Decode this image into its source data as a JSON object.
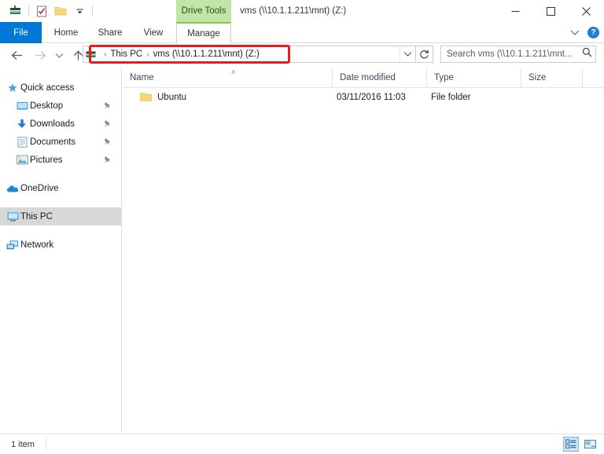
{
  "window": {
    "title": "vms (\\\\10.1.1.211\\mnt) (Z:)",
    "contextual_tab_group": "Drive Tools",
    "minimize_label": "—",
    "maximize_label": "☐",
    "close_label": "✕"
  },
  "quick_access_toolbar": {
    "items": [
      {
        "name": "map-network-drive-icon",
        "label": ""
      },
      {
        "name": "properties-icon",
        "label": ""
      },
      {
        "name": "new-folder-icon",
        "label": ""
      },
      {
        "name": "customize-qat-chevron-icon",
        "label": "∴"
      }
    ]
  },
  "ribbon": {
    "tabs": [
      {
        "label": "File",
        "state": "file"
      },
      {
        "label": "Home",
        "state": "normal"
      },
      {
        "label": "Share",
        "state": "normal"
      },
      {
        "label": "View",
        "state": "normal"
      },
      {
        "label": "Manage",
        "state": "active"
      }
    ],
    "expand_icon": "⌄",
    "help_label": "?"
  },
  "navigation": {
    "back_icon": "←",
    "forward_icon": "→",
    "recent_icon": "⌄",
    "up_icon": "↑",
    "address": {
      "crumbs": [
        "This PC",
        "vms (\\\\10.1.1.211\\mnt) (Z:)"
      ],
      "separator": "›",
      "dropdown_icon": "⌄"
    },
    "refresh_icon": "↻",
    "search": {
      "placeholder": "Search vms (\\\\10.1.1.211\\mnt...",
      "icon": "⌕"
    }
  },
  "sidebar": {
    "items": [
      {
        "label": "Quick access",
        "icon": "star-pin-icon",
        "indent": false,
        "pinned": false,
        "selected": false
      },
      {
        "label": "Desktop",
        "icon": "desktop-icon",
        "indent": true,
        "pinned": true,
        "selected": false
      },
      {
        "label": "Downloads",
        "icon": "downloads-icon",
        "indent": true,
        "pinned": true,
        "selected": false
      },
      {
        "label": "Documents",
        "icon": "documents-icon",
        "indent": true,
        "pinned": true,
        "selected": false
      },
      {
        "label": "Pictures",
        "icon": "pictures-icon",
        "indent": true,
        "pinned": true,
        "selected": false
      },
      {
        "label": "OneDrive",
        "icon": "onedrive-cloud-icon",
        "indent": false,
        "pinned": false,
        "selected": false
      },
      {
        "label": "This PC",
        "icon": "this-pc-icon",
        "indent": false,
        "pinned": false,
        "selected": true
      },
      {
        "label": "Network",
        "icon": "network-icon",
        "indent": false,
        "pinned": false,
        "selected": false
      }
    ],
    "pin_glyph": "📌"
  },
  "file_list": {
    "columns": [
      {
        "label": "Name",
        "sorted": "asc",
        "sort_glyph": "˄"
      },
      {
        "label": "Date modified",
        "sorted": "",
        "sort_glyph": ""
      },
      {
        "label": "Type",
        "sorted": "",
        "sort_glyph": ""
      },
      {
        "label": "Size",
        "sorted": "",
        "sort_glyph": ""
      }
    ],
    "rows": [
      {
        "name": "Ubuntu",
        "date_modified": "03/11/2016 11:03",
        "type": "File folder",
        "size": "",
        "icon": "folder-icon"
      }
    ]
  },
  "status_bar": {
    "item_count": "1 item",
    "details_view_label": "",
    "large_icons_view_label": ""
  }
}
